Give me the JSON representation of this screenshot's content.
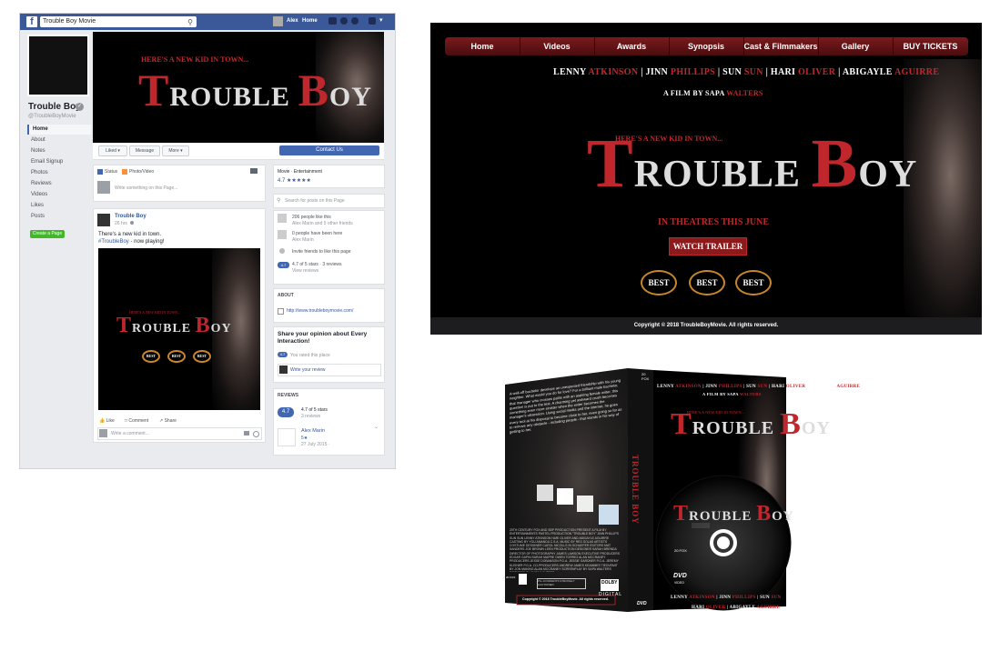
{
  "facebook": {
    "logo": "f",
    "search_value": "Trouble Boy Movie",
    "top_user": "Alex",
    "top_home": "Home",
    "page_name": "Trouble Boy",
    "handle": "@TroubleBoyMovie",
    "nav": [
      "Home",
      "About",
      "Notes",
      "Email Signup",
      "Photos",
      "Reviews",
      "Videos",
      "Likes",
      "Posts"
    ],
    "create_page": "Create a Page",
    "actions": {
      "liked": "Liked ▾",
      "message": "Message",
      "more": "More ▾",
      "contact": "Contact Us"
    },
    "composer": {
      "status": "Status",
      "photo": "Photo/Video",
      "placeholder": "Write something on this Page..."
    },
    "post": {
      "author": "Trouble Boy",
      "time": "26 hrs",
      "text": "There's a new kid in town.",
      "tag": "#TroubleBoy",
      "tag_rest": " - now playing!",
      "like": "Like",
      "comment": "Comment",
      "share": "Share",
      "comment_placeholder": "Write a comment..."
    },
    "sidebar": {
      "category": "Movie · Entertainment",
      "rating": "4.7",
      "stars": "★★★★★",
      "search_placeholder": "Search for posts on this Page",
      "likes": "206 people like this",
      "likes_sub": "Alex Marin and 5 other friends",
      "been_here": "0 people have been here",
      "been_sub": "Alex Marin",
      "invite": "Invite friends to like this page",
      "rating_badge": "4.7",
      "rating_text": "4.7 of 5 stars · 3 reviews",
      "view_reviews": "View reviews",
      "about_header": "ABOUT",
      "website": "http://www.troubleboymovie.com/",
      "opinion_title": "Share your opinion about Every Interaction!",
      "rated_badge": "4.7",
      "rated_text": "You rated this place",
      "write_review": "Write your review",
      "reviews_header": "REVIEWS",
      "reviews_score": "4.7 of 5 stars",
      "reviews_count": "3 reviews",
      "reviewer": "Alex Marin",
      "reviewer_stars": "5★",
      "review_date": "27 July 2015 · "
    }
  },
  "poster": {
    "tagline": "HERE'S A NEW KID IN TOWN...",
    "title_t": "T",
    "title_rouble": "ROUBLE",
    "title_b": "B",
    "title_oy": "OY",
    "laurel": "BEST"
  },
  "website": {
    "nav": [
      "Home",
      "Videos",
      "Awards",
      "Synopsis",
      "Cast & Filmmakers",
      "Gallery",
      "BUY TICKETS"
    ],
    "cast": [
      {
        "first": "LENNY",
        "last": "ATKINSON"
      },
      {
        "first": "JINN",
        "last": "PHILLIPS"
      },
      {
        "first": "SUN",
        "last": "SUN"
      },
      {
        "first": "HARI",
        "last": "OLIVER"
      },
      {
        "first": "ABIGAYLE",
        "last": "AGUIRRE"
      }
    ],
    "film_by": "A FILM BY SAPA",
    "film_by_last": "WALTERS",
    "in_theatres": "IN THEATRES THIS JUNE",
    "watch_trailer": "WATCH TRAILER",
    "footer": "Copyright © 2018 TroubleBoyMovie. All rights reserved."
  },
  "dvd": {
    "synopsis": "A well-off bachelor develops an unexpected friendship with his young neighbor. What would you do for love? For a brilliant male bachelor, that manager who crosses paths with an aspiring female writer, this question is put to the test. A charming yet awkward crush becomes something even more sinister when the writer becomes the manager's obsession. Using social media and the internet, he goes every tool at his disposal to become close to her, even going so far as to remove any obstacle - including people - that stands in his way of getting to her.",
    "spine_title": "TROUBLE BOY",
    "credits": "20TH CENTURY FOX AND SBP PRODUCTION PRESENT A FILM BY ENTERTAINMENTS PASTEL PRODUCTION \"TROUBLE BOY\" JINN PHILLIPS SUN SUN LENNY ATKINSON HARI OLIVER AND ABIGAYLE AGUIRRE CASTING BY YOU AMANDA C.S.A. MUSIC BY RED SOLAS ARTISTS COSTUME DESIGNER CAROL NICOLLS IN SCHAEFER EDITORS MAT SANDERS JOE BROWN LEEN PRODUCTION DESIGNER SARAH BRENDA DIRECTOR OF PHOTOGRAPHY JAMES LAWSON EXECUTIVE PRODUCERS EDGAR GAPIN SARAH MAPRE OWEN TORREZ ALAN MCCRANEY PRODUCERS JESSE DOBANSON P.G.A. JESSIE GARDNER P.G.A. JEREMY KLEINER P.G.A. CO-PRODUCERS ANDREW JAMES KEAMMES TIEDVEMIT BY JON MAKING ALAN MCCRANEY SCREENPLAY BY SAPA WALTERS DIRECTED BY SAPA WALTERS",
    "rating_box": "PG-13 PARENTS STRONGLY CAUTIONED",
    "dolby": "DOLBY",
    "digital": "DIGITAL",
    "copyright": "Copyright © 2018 TroubleBoyMovie. All rights reserved.",
    "dvd_logo": "DVD",
    "video": "VIDEO",
    "fox": "20 FOX"
  }
}
